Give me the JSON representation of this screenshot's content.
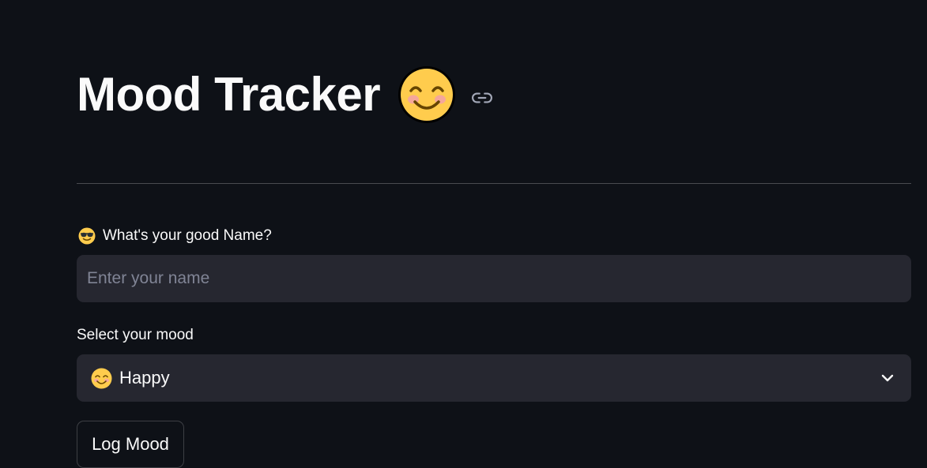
{
  "header": {
    "title": "Mood Tracker",
    "title_icon": "smiling-face-emoji",
    "anchor_icon": "link-icon"
  },
  "name_field": {
    "label": "What's your good Name?",
    "label_icon": "sunglasses-face-emoji",
    "placeholder": "Enter your name",
    "value": ""
  },
  "mood_select": {
    "label": "Select your mood",
    "selected_icon": "smiling-face-emoji",
    "selected_value": "Happy",
    "dropdown_icon": "chevron-down-icon"
  },
  "actions": {
    "log_button_label": "Log Mood"
  },
  "colors": {
    "background": "#0e1117",
    "input_background": "#262730",
    "text": "#fafafa",
    "placeholder": "#808495",
    "emoji_yellow": "#ffcc4d"
  }
}
